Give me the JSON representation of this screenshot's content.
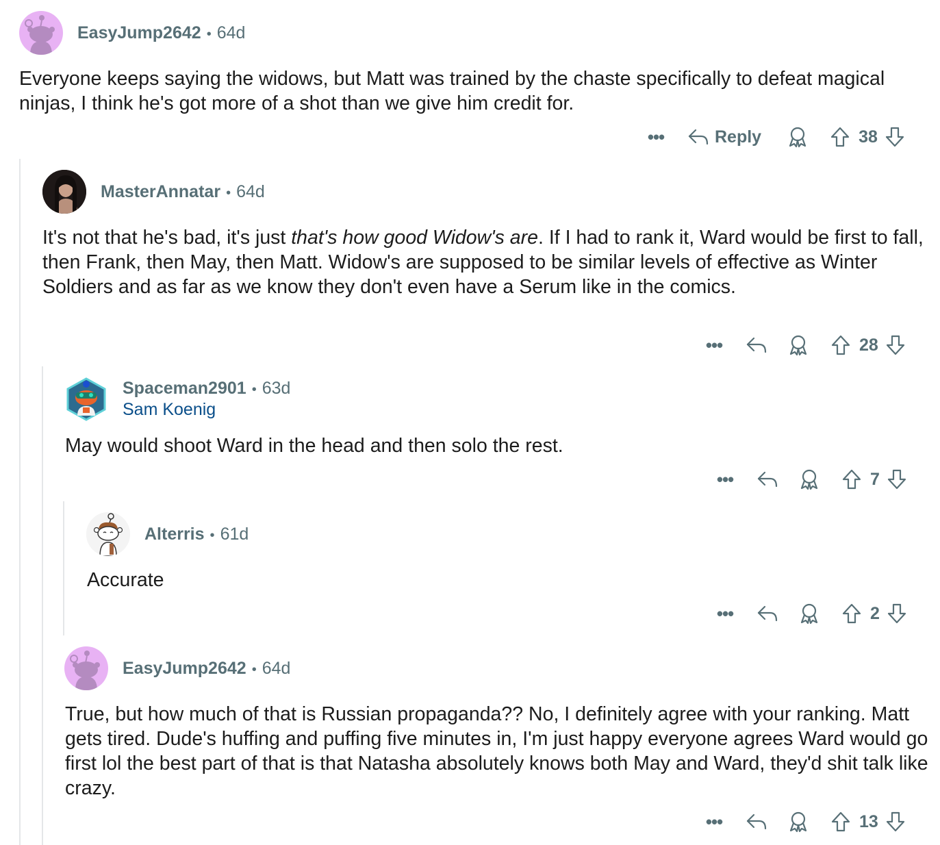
{
  "comments": [
    {
      "user": "EasyJump2642",
      "age": "64d",
      "text": "Everyone keeps saying the widows, but Matt was trained by the chaste specifically to defeat magical ninjas, I think he's got more of a shot than we give him credit for.",
      "reply_label": "Reply",
      "votes": "38"
    },
    {
      "user": "MasterAnnatar",
      "age": "64d",
      "text_before": "It's not that he's bad, it's just ",
      "text_italic": "that's how good Widow's are",
      "text_after": ". If I had to rank it, Ward would be first to fall, then Frank, then May, then Matt. Widow's are supposed to be similar levels of effective as Winter Soldiers and as far as we know they don't even have a Serum like in the comics.",
      "votes": "28"
    },
    {
      "user": "Spaceman2901",
      "age": "63d",
      "flair": "Sam Koenig",
      "text": "May would shoot Ward in the head and then solo the rest.",
      "votes": "7"
    },
    {
      "user": "Alterris",
      "age": "61d",
      "text": "Accurate",
      "votes": "2"
    },
    {
      "user": "EasyJump2642",
      "age": "64d",
      "text": "True, but how much of that is Russian propaganda?? No, I definitely agree with your ranking. Matt gets tired. Dude's huffing and puffing five minutes in, I'm just happy everyone agrees Ward would go first lol the best part of that is that Natasha absolutely knows both May and Ward, they'd shit talk like crazy.",
      "votes": "13"
    }
  ],
  "icons": {
    "more": "more-options-icon",
    "reply": "reply-arrow-icon",
    "award": "award-icon",
    "upvote": "upvote-arrow-icon",
    "downvote": "downvote-arrow-icon"
  },
  "colors": {
    "meta": "#576f76",
    "flair": "#0b4f8a",
    "thread_line": "#e4e6e8",
    "avatar_snoo_bg": "#e8b2f4"
  }
}
